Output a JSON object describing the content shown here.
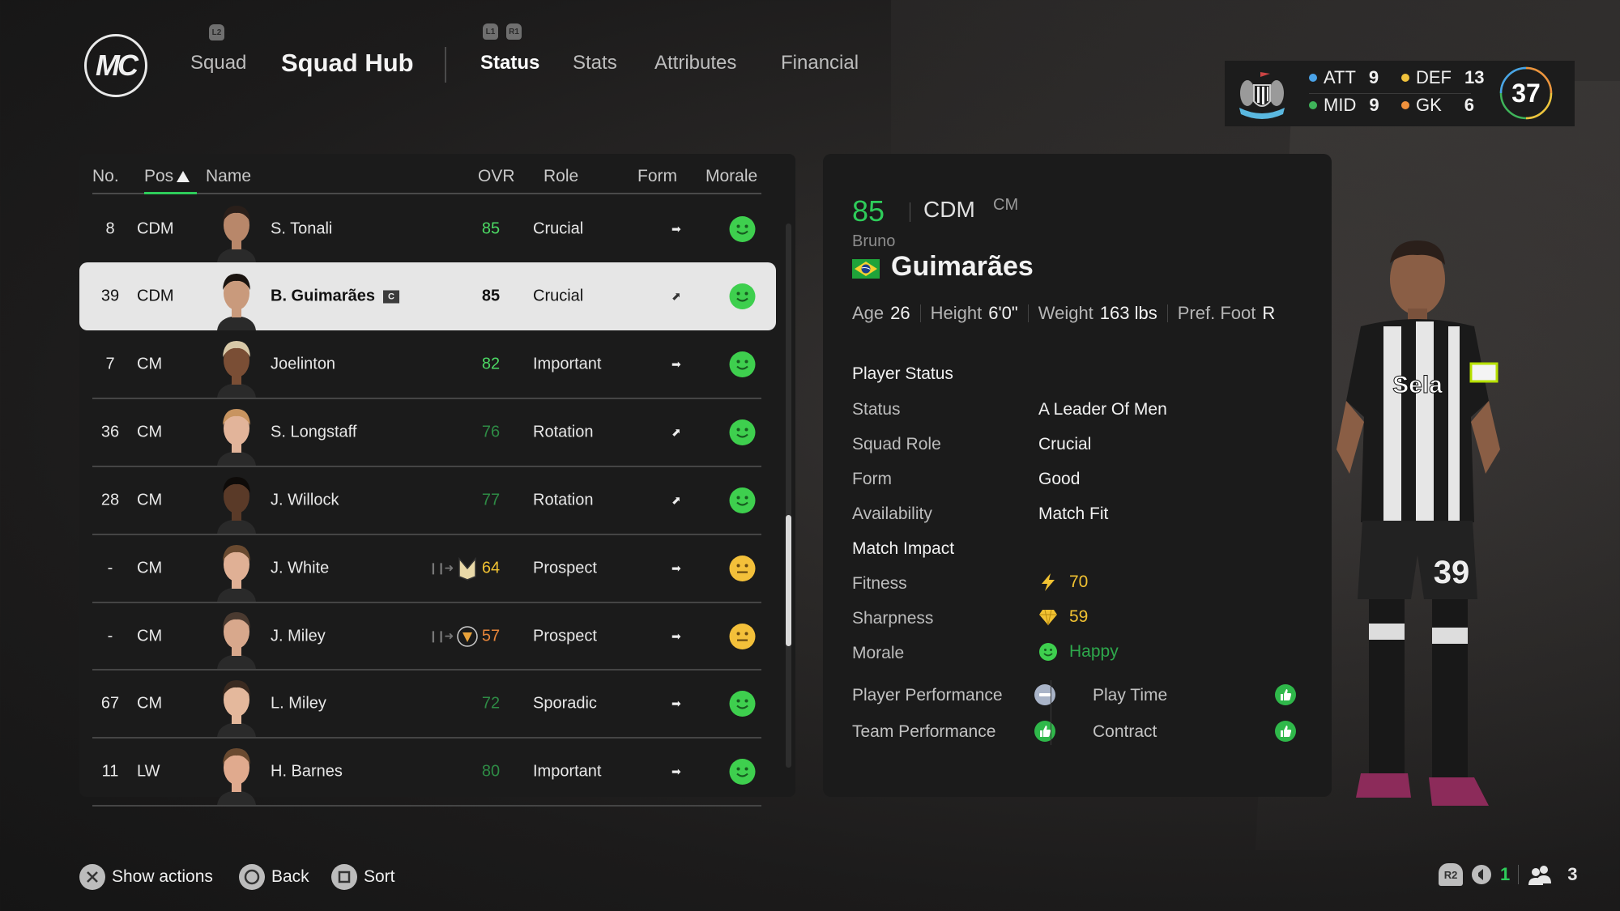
{
  "nav": {
    "logo": "MC",
    "squad_hint": "L2",
    "squad": "Squad",
    "hub_title": "Squad Hub",
    "tab_hints": [
      "L1",
      "R1"
    ],
    "tabs": [
      {
        "label": "Status",
        "active": true
      },
      {
        "label": "Stats",
        "active": false
      },
      {
        "label": "Attributes",
        "active": false
      },
      {
        "label": "Financial",
        "active": false
      }
    ]
  },
  "club_summary": {
    "att_label": "ATT",
    "att": "9",
    "mid_label": "MID",
    "mid": "9",
    "def_label": "DEF",
    "def": "13",
    "gk_label": "GK",
    "gk": "6",
    "total": "37",
    "colors": {
      "att": "#4aa3e8",
      "mid": "#3fb45a",
      "def": "#f0c23c",
      "gk": "#f0913c"
    }
  },
  "table": {
    "headers": {
      "no": "No.",
      "pos": "Pos",
      "name": "Name",
      "ovr": "OVR",
      "role": "Role",
      "form": "Form",
      "morale": "Morale"
    },
    "sort_column": "Pos",
    "sort_direction": "ascending",
    "rows": [
      {
        "no": "8",
        "pos": "CDM",
        "name": "S. Tonali",
        "ovr": "85",
        "ovr_color": "#4cd964",
        "role": "Crucial",
        "form": "steady",
        "form_glyph": "➡",
        "morale": "happy",
        "selected": false
      },
      {
        "no": "39",
        "pos": "CDM",
        "name": "B. Guimarães",
        "captain": "C",
        "ovr": "85",
        "ovr_color": "#111111",
        "role": "Crucial",
        "form": "improving",
        "form_glyph": "⬈",
        "morale": "happy",
        "selected": true
      },
      {
        "no": "7",
        "pos": "CM",
        "name": "Joelinton",
        "ovr": "82",
        "ovr_color": "#4cd964",
        "role": "Important",
        "form": "steady",
        "form_glyph": "➡",
        "morale": "happy",
        "selected": false
      },
      {
        "no": "36",
        "pos": "CM",
        "name": "S. Longstaff",
        "ovr": "76",
        "ovr_color": "#2e8b45",
        "role": "Rotation",
        "form": "improving",
        "form_glyph": "⬈",
        "morale": "happy",
        "selected": false
      },
      {
        "no": "28",
        "pos": "CM",
        "name": "J. Willock",
        "ovr": "77",
        "ovr_color": "#2e8b45",
        "role": "Rotation",
        "form": "improving",
        "form_glyph": "⬈",
        "morale": "happy",
        "selected": false
      },
      {
        "no": "-",
        "pos": "CM",
        "name": "J. White",
        "loan_club": "MK Dons",
        "ovr": "64",
        "ovr_color": "#f1c232",
        "role": "Prospect",
        "form": "steady",
        "form_glyph": "➡",
        "morale": "neutral",
        "selected": false
      },
      {
        "no": "-",
        "pos": "CM",
        "name": "J. Miley",
        "loan_club": "Newport County",
        "ovr": "57",
        "ovr_color": "#e8863a",
        "role": "Prospect",
        "form": "steady",
        "form_glyph": "➡",
        "morale": "neutral",
        "selected": false
      },
      {
        "no": "67",
        "pos": "CM",
        "name": "L. Miley",
        "ovr": "72",
        "ovr_color": "#2e8b45",
        "role": "Sporadic",
        "form": "steady",
        "form_glyph": "➡",
        "morale": "happy",
        "selected": false
      },
      {
        "no": "11",
        "pos": "LW",
        "name": "H. Barnes",
        "ovr": "80",
        "ovr_color": "#2e8b45",
        "role": "Important",
        "form": "steady",
        "form_glyph": "➡",
        "morale": "happy",
        "selected": false
      }
    ],
    "scroll_position": 0.55
  },
  "player": {
    "ovr": "85",
    "position": "CDM",
    "alt_position": "CM",
    "first_name": "Bruno",
    "last_name": "Guimarães",
    "nationality": "Brazil",
    "bio": {
      "age_label": "Age",
      "age": "26",
      "height_label": "Height",
      "height": "6'0\"",
      "weight_label": "Weight",
      "weight": "163 lbs",
      "foot_label": "Pref. Foot",
      "foot": "R"
    },
    "status_title": "Player Status",
    "status": [
      {
        "label": "Status",
        "value": "A Leader Of Men"
      },
      {
        "label": "Squad Role",
        "value": "Crucial"
      },
      {
        "label": "Form",
        "value": "Good"
      },
      {
        "label": "Availability",
        "value": "Match Fit"
      }
    ],
    "impact_title": "Match Impact",
    "impact": {
      "fitness_label": "Fitness",
      "fitness": "70",
      "sharpness_label": "Sharpness",
      "sharpness": "59",
      "morale_label": "Morale",
      "morale": "Happy"
    },
    "factors": [
      {
        "label": "Player Performance",
        "state": "neutral"
      },
      {
        "label": "Team Performance",
        "state": "positive"
      },
      {
        "label": "Play Time",
        "state": "positive"
      },
      {
        "label": "Contract",
        "state": "positive"
      }
    ],
    "shirt_number": "39",
    "shirt_sponsor": "Sela"
  },
  "footer": {
    "actions": [
      {
        "button": "cross",
        "label": "Show actions"
      },
      {
        "button": "circle",
        "label": "Back"
      },
      {
        "button": "square",
        "label": "Sort"
      }
    ],
    "r2_label": "R2",
    "notifications": "1",
    "players_online": "3"
  }
}
